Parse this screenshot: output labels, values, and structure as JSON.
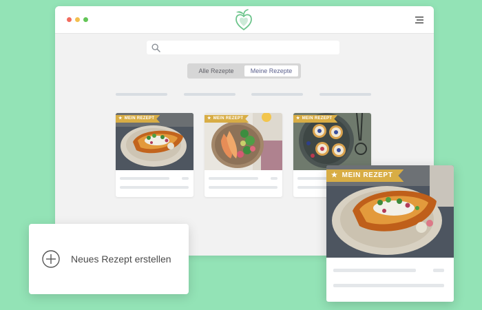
{
  "colors": {
    "background": "#93e3b6",
    "accent_green": "#6cc48b",
    "badge_gold": "#d8ad45",
    "window_bg": "#f2f2f2"
  },
  "window": {
    "traffic_lights": [
      "#f26b5e",
      "#f3bf4f",
      "#63c557"
    ],
    "logo": "apple-heart-logo-icon",
    "menu_icon": "hamburger-menu-icon"
  },
  "search": {
    "icon": "search-icon",
    "placeholder": ""
  },
  "tabs": [
    {
      "label": "Alle Rezepte",
      "active": false
    },
    {
      "label": "Meine Rezepte",
      "active": true
    }
  ],
  "recipe_cards": [
    {
      "badge": "MEIN REZEPT",
      "image": "baked-sweet-potato-photo"
    },
    {
      "badge": "MEIN REZEPT",
      "image": "salad-bowl-photo"
    },
    {
      "badge": "MEIN REZEPT",
      "image": "mini-tarts-tray-photo"
    }
  ],
  "featured_card": {
    "badge": "MEIN REZEPT",
    "image": "baked-sweet-potato-photo"
  },
  "new_recipe": {
    "label": "Neues Rezept erstellen",
    "icon": "plus-circle-icon"
  }
}
